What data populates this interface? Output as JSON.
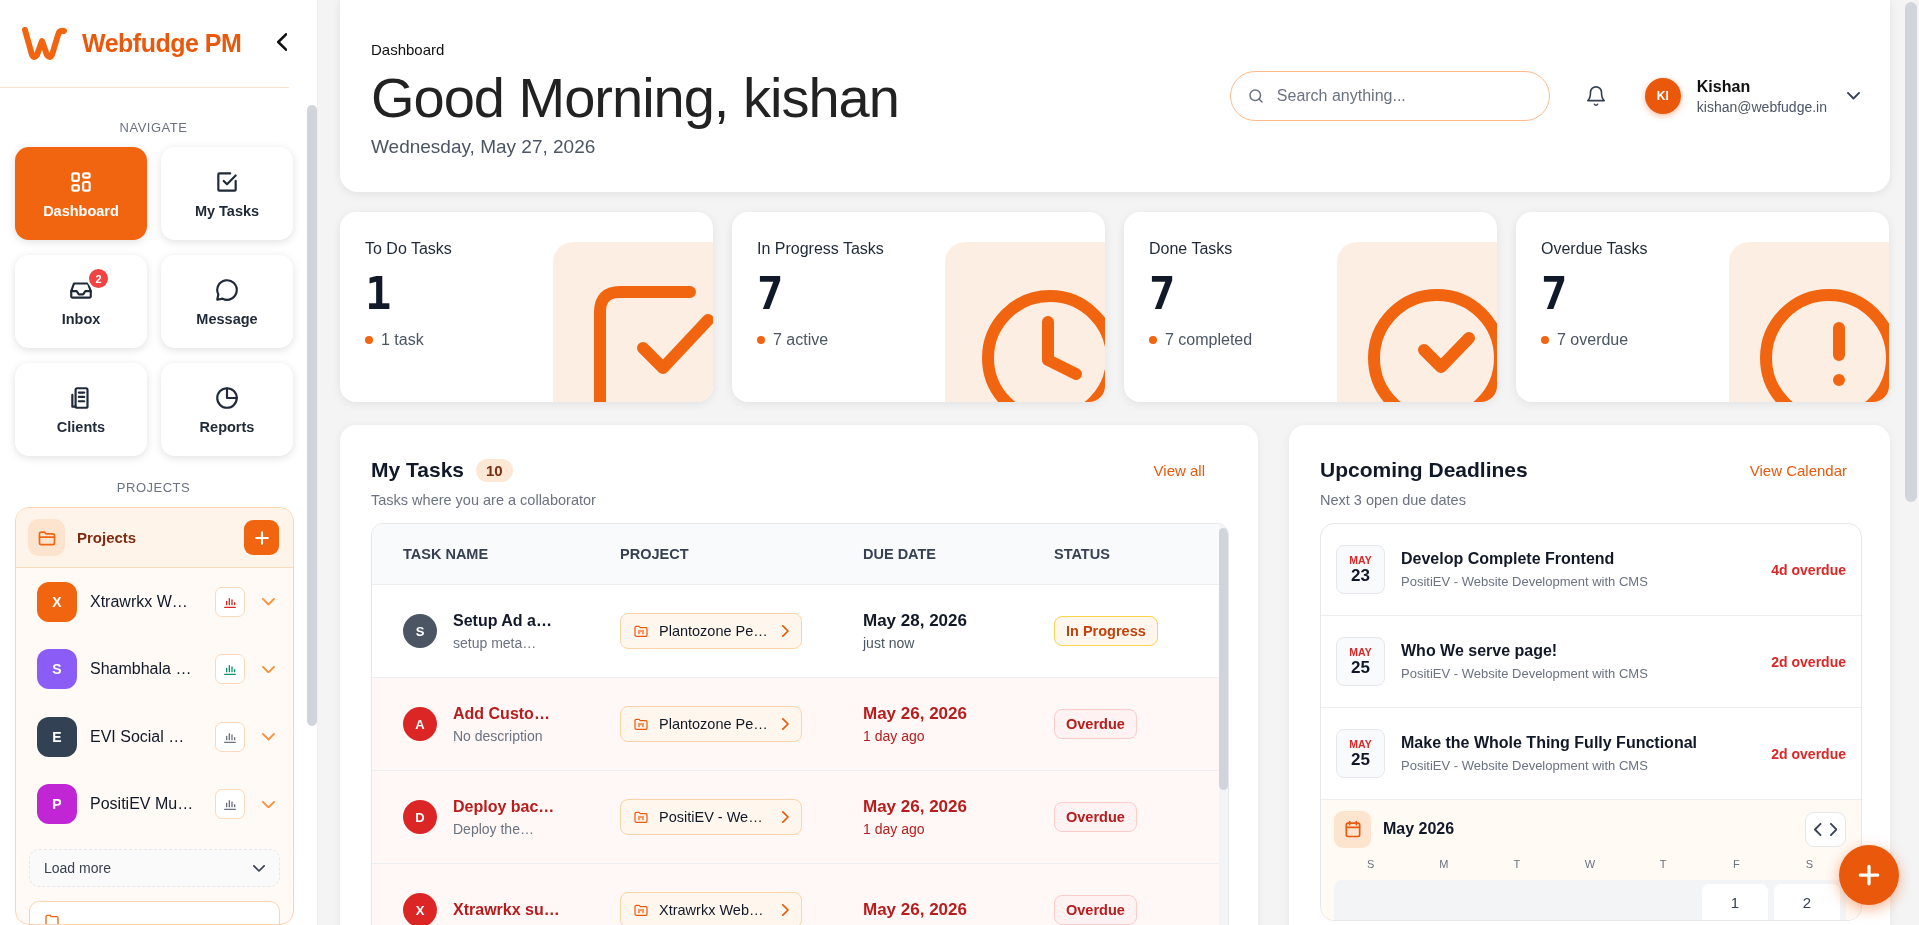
{
  "sidebar": {
    "logo": "Webfudge PM",
    "nav_heading": "NAVIGATE",
    "nav_items": [
      {
        "label": "Dashboard",
        "selected": true
      },
      {
        "label": "My Tasks",
        "selected": false
      },
      {
        "label": "Inbox",
        "selected": false,
        "badge": "2"
      },
      {
        "label": "Message",
        "selected": false
      },
      {
        "label": "Clients",
        "selected": false
      },
      {
        "label": "Reports",
        "selected": false
      }
    ],
    "projects_heading": "PROJECTS",
    "projects_panel": {
      "title": "Projects",
      "projects": [
        {
          "initial": "X",
          "name": "Xtrawrkx W…",
          "color": "#f26510",
          "kind": "at_risk"
        },
        {
          "initial": "S",
          "name": "Shambhala …",
          "color": "#8b5cf6",
          "kind": "on_track"
        },
        {
          "initial": "E",
          "name": "EVI Social …",
          "color": "#334155",
          "kind": "idle"
        },
        {
          "initial": "P",
          "name": "PositiEV Mu…",
          "color": "#c026d3",
          "kind": "idle"
        }
      ],
      "load_more": "Load more"
    }
  },
  "header": {
    "breadcrumb": "Dashboard",
    "greeting": "Good Morning, kishan",
    "date": "Wednesday, May 27, 2026",
    "search": {
      "placeholder": "Search anything..."
    },
    "user": {
      "initials": "KI",
      "name": "Kishan",
      "email": "kishan@webfudge.in"
    }
  },
  "stats": [
    {
      "label": "To Do Tasks",
      "value": "1",
      "note": "1 task",
      "kind": "todo"
    },
    {
      "label": "In Progress Tasks",
      "value": "7",
      "note": "7 active",
      "kind": "progress"
    },
    {
      "label": "Done Tasks",
      "value": "7",
      "note": "7 completed",
      "kind": "done"
    },
    {
      "label": "Overdue Tasks",
      "value": "7",
      "note": "7 overdue",
      "kind": "overdue"
    }
  ],
  "my_tasks": {
    "title": "My Tasks",
    "count": "10",
    "view_all": "View all",
    "subtitle": "Tasks where you are a collaborator",
    "columns": [
      "TASK NAME",
      "PROJECT",
      "DUE DATE",
      "STATUS"
    ],
    "rows": [
      {
        "initial": "S",
        "color": "#4b5563",
        "name": "Setup Ad a…",
        "description": "setup meta…",
        "project": "Plantozone Pe…",
        "due_date": "May 28, 2026",
        "due_relative": "just now",
        "status": "In Progress",
        "kind": "in_progress",
        "overdue": false
      },
      {
        "initial": "A",
        "color": "#dc2626",
        "name": "Add Custo…",
        "description": "No description",
        "project": "Plantozone Pe…",
        "due_date": "May 26, 2026",
        "due_relative": "1 day ago",
        "status": "Overdue",
        "kind": "overdue",
        "overdue": true
      },
      {
        "initial": "D",
        "color": "#dc2626",
        "name": "Deploy bac…",
        "description": "Deploy the…",
        "project": "PositiEV - We…",
        "due_date": "May 26, 2026",
        "due_relative": "1 day ago",
        "status": "Overdue",
        "kind": "overdue",
        "overdue": true
      },
      {
        "initial": "X",
        "color": "#dc2626",
        "name": "Xtrawrkx su…",
        "project": "Xtrawrkx Web…",
        "due_date": "May 26, 2026",
        "status": "Overdue",
        "kind": "overdue",
        "overdue": true
      }
    ]
  },
  "deadlines": {
    "title": "Upcoming Deadlines",
    "link": "View Calendar",
    "subtitle": "Next 3 open due dates",
    "items": [
      {
        "month": "MAY",
        "day": "23",
        "title": "Develop Complete Frontend",
        "project": "PositiEV - Website Development with CMS",
        "overdue": "4d overdue"
      },
      {
        "month": "MAY",
        "day": "25",
        "title": "Who We serve page!",
        "project": "PositiEV - Website Development with CMS",
        "overdue": "2d overdue"
      },
      {
        "month": "MAY",
        "day": "25",
        "title": "Make the Whole Thing Fully Functional",
        "project": "PositiEV - Website Development with CMS",
        "overdue": "2d overdue"
      }
    ],
    "calendar": {
      "month": "May 2026",
      "weekdays": [
        "S",
        "M",
        "T",
        "W",
        "T",
        "F",
        "S"
      ],
      "first_week_days": [
        "1",
        "2"
      ]
    }
  }
}
